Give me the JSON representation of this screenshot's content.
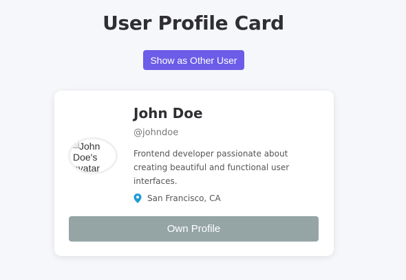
{
  "page": {
    "title": "User Profile Card"
  },
  "toolbar": {
    "switch_user_label": "Show as Other User"
  },
  "profile": {
    "avatar_alt": "John Doe's avatar",
    "name": "John Doe",
    "handle": "@johndoe",
    "bio": "Frontend developer passionate about creating beautiful and functional user interfaces.",
    "location": "San Francisco, CA",
    "location_icon": "map-pin-icon",
    "action_label": "Own Profile"
  },
  "colors": {
    "accent": "#6c5ce7",
    "disabled_button": "#95a5a6",
    "pin": "#1e9bd7",
    "background": "#f6f7fa"
  }
}
